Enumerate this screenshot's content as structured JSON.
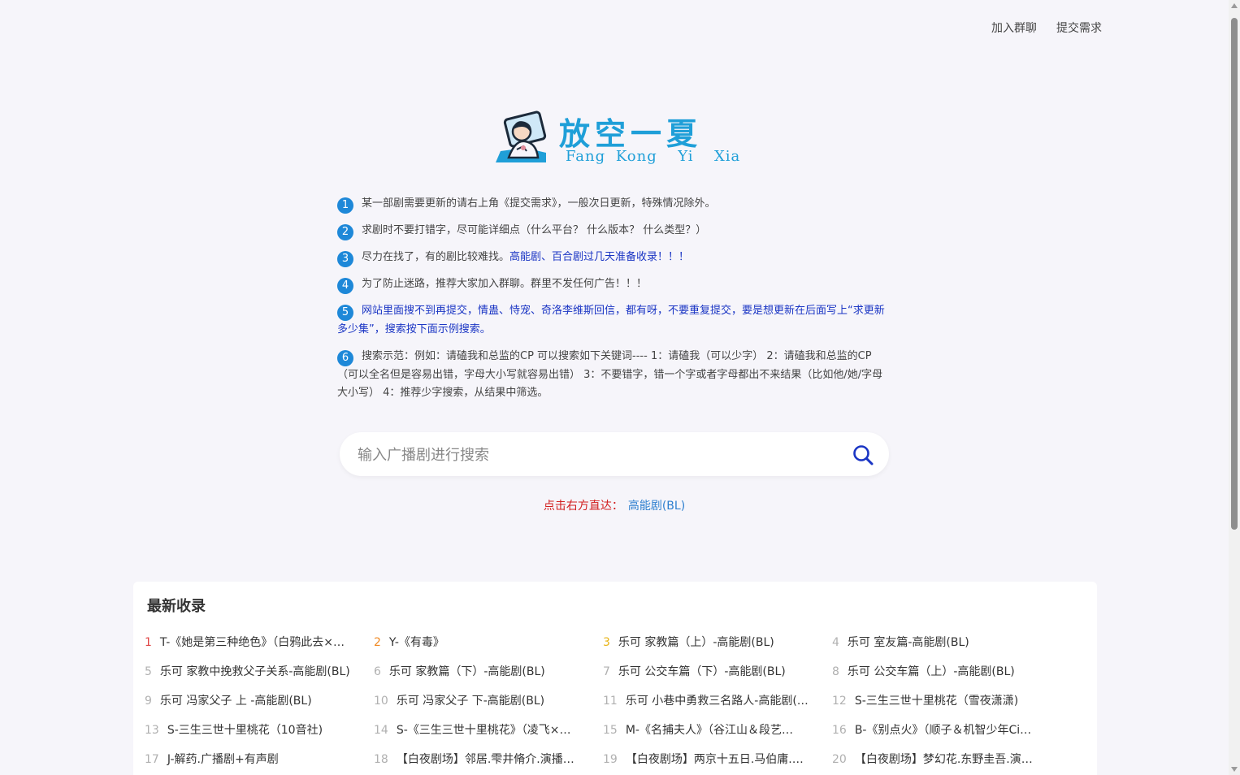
{
  "nav": {
    "join_group": "加入群聊",
    "submit_request": "提交需求"
  },
  "logo": {
    "title": "放空一夏",
    "pinyin": "Fang Kong  Yi  Xia"
  },
  "notices": [
    {
      "num": "1",
      "segments": [
        {
          "text": "某一部剧需要更新的请右上角《提交需求》，一般次日更新，特殊情况除外。",
          "color": "normal"
        }
      ]
    },
    {
      "num": "2",
      "segments": [
        {
          "text": "求剧时不要打错字，尽可能详细点（什么平台？ 什么版本？ 什么类型？）",
          "color": "normal"
        }
      ]
    },
    {
      "num": "3",
      "segments": [
        {
          "text": "尽力在找了，有的剧比较难找。",
          "color": "normal"
        },
        {
          "text": "高能剧、百合剧过几天准备收录！！！",
          "color": "blue"
        }
      ]
    },
    {
      "num": "4",
      "segments": [
        {
          "text": "为了防止迷路，推荐大家加入群聊。群里不发任何广告！！！",
          "color": "normal"
        }
      ]
    },
    {
      "num": "5",
      "segments": [
        {
          "text": "网站里面搜不到再提交，情蛊、恃宠、奇洛李维斯回信，都有呀，不要重复提交，要是想更新在后面写上“求更新多少集”，搜索按下面示例搜索。",
          "color": "blue"
        }
      ]
    },
    {
      "num": "6",
      "segments": [
        {
          "text": "搜索示范：例如：请磕我和总监的CP 可以搜索如下关键词---- 1：请磕我（可以少字） 2：请磕我和总监的CP（可以全名但是容易出错，字母大小写就容易出错） 3：不要错字，错一个字或者字母都出不来结果（比如他/她/字母大小写） 4：推荐少字搜索，从结果中筛选。",
          "color": "normal"
        }
      ]
    }
  ],
  "search": {
    "placeholder": "输入广播剧进行搜索"
  },
  "direct": {
    "label": "点击右方直达：",
    "link": "高能剧(BL)"
  },
  "latest": {
    "title": "最新收录",
    "items": [
      {
        "rank": "1",
        "text": "T-《她是第三种绝色》（白鸦此去×…"
      },
      {
        "rank": "2",
        "text": "Y-《有毒》"
      },
      {
        "rank": "3",
        "text": "乐可 家教篇（上）-高能剧(BL)"
      },
      {
        "rank": "4",
        "text": "乐可 室友篇-高能剧(BL)"
      },
      {
        "rank": "5",
        "text": "乐可 家教中挽救父子关系-高能剧(BL)"
      },
      {
        "rank": "6",
        "text": "乐可 家教篇（下）-高能剧(BL)"
      },
      {
        "rank": "7",
        "text": "乐可 公交车篇（下）-高能剧(BL)"
      },
      {
        "rank": "8",
        "text": "乐可 公交车篇（上）-高能剧(BL)"
      },
      {
        "rank": "9",
        "text": "乐可 冯家父子 上 -高能剧(BL)"
      },
      {
        "rank": "10",
        "text": "乐可 冯家父子 下-高能剧(BL)"
      },
      {
        "rank": "11",
        "text": "乐可 小巷中勇救三名路人-高能剧(…"
      },
      {
        "rank": "12",
        "text": "S-三生三世十里桃花（雪夜潇潇)"
      },
      {
        "rank": "13",
        "text": "S-三生三世十里桃花（10音社)"
      },
      {
        "rank": "14",
        "text": "S-《三生三世十里桃花》（凌飞×…"
      },
      {
        "rank": "15",
        "text": "M-《名捕夫人》（谷江山＆段艺…"
      },
      {
        "rank": "16",
        "text": "B-《别点火》（顺子＆机智少年Ci…"
      },
      {
        "rank": "17",
        "text": "J-解药.广播剧+有声剧"
      },
      {
        "rank": "18",
        "text": "【白夜剧场】邻居.雫井脩介.演播…"
      },
      {
        "rank": "19",
        "text": "【白夜剧场】两京十五日.马伯庸.…"
      },
      {
        "rank": "20",
        "text": "【白夜剧场】梦幻花.东野圭吾.演…"
      }
    ]
  },
  "colors": {
    "accent": "#1e88d8",
    "logo": "#1f9fd8",
    "blue_text": "#1a35c4",
    "red_text": "#d21e1e",
    "link": "#2d7fcf"
  }
}
